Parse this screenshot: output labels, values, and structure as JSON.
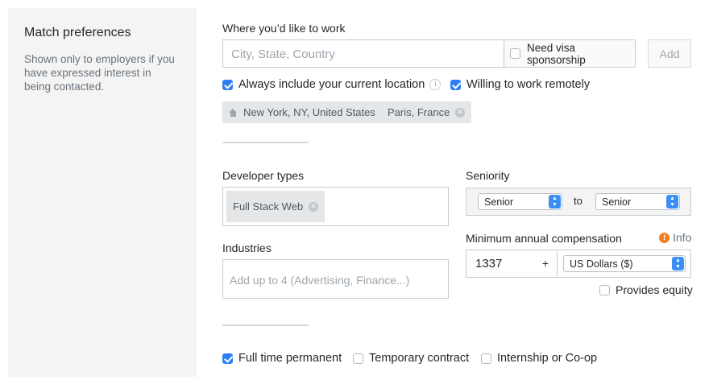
{
  "sidebar": {
    "title": "Match preferences",
    "description": "Shown only to employers if you have expressed interest in being contacted."
  },
  "location": {
    "label": "Where you’d like to work",
    "placeholder": "City, State, Country",
    "visa_label": "Need visa sponsorship",
    "visa_checked": false,
    "add_label": "Add",
    "include_current_label": "Always include your current location",
    "include_current_checked": true,
    "remote_label": "Willing to work remotely",
    "remote_checked": true,
    "tags": [
      {
        "label": "New York, NY, United States",
        "icon": "home-icon"
      },
      {
        "label": "Paris, France",
        "icon": "remove-icon"
      }
    ]
  },
  "developer_types": {
    "label": "Developer types",
    "tags": [
      {
        "label": "Full Stack Web"
      }
    ]
  },
  "industries": {
    "label": "Industries",
    "placeholder": "Add up to 4 (Advertising, Finance...)"
  },
  "seniority": {
    "label": "Seniority",
    "from": "Senior",
    "separator": "to",
    "to": "Senior"
  },
  "compensation": {
    "label": "Minimum annual compensation",
    "info_label": "Info",
    "info_icon": "!",
    "amount": "1337",
    "plus": "+",
    "currency": "US Dollars ($)",
    "equity_label": "Provides equity",
    "equity_checked": false
  },
  "job_types": [
    {
      "label": "Full time permanent",
      "checked": true
    },
    {
      "label": "Temporary contract",
      "checked": false
    },
    {
      "label": "Internship or Co-op",
      "checked": false
    }
  ],
  "colors": {
    "checkbox_accent": "#2f7ef5",
    "info_accent": "#f48024",
    "sidebar_bg": "#f4f4f4"
  }
}
